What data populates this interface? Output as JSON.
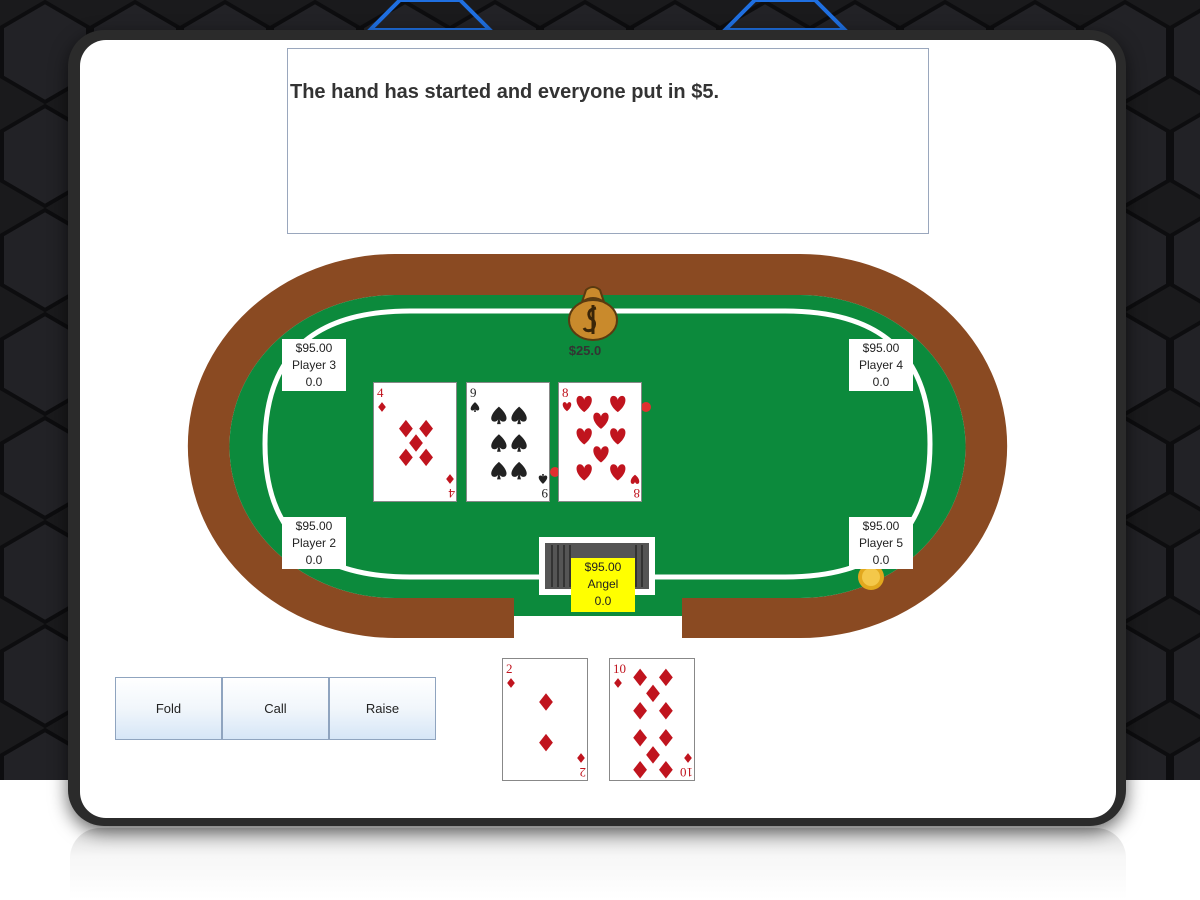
{
  "message": "The hand has started and everyone put in $5.",
  "pot": {
    "amount": "$25.0",
    "icon": "money-bag-icon"
  },
  "players": [
    {
      "id": "player3",
      "stack": "$95.00",
      "name": "Player 3",
      "bet": "0.0"
    },
    {
      "id": "player4",
      "stack": "$95.00",
      "name": "Player 4",
      "bet": "0.0"
    },
    {
      "id": "player2",
      "stack": "$95.00",
      "name": "Player 2",
      "bet": "0.0"
    },
    {
      "id": "player5",
      "stack": "$95.00",
      "name": "Player 5",
      "bet": "0.0"
    },
    {
      "id": "hero",
      "stack": "$95.00",
      "name": "Angel",
      "bet": "0.0"
    }
  ],
  "community_cards": [
    {
      "rank": "4",
      "suit": "diamonds"
    },
    {
      "rank": "9",
      "suit": "spades"
    },
    {
      "rank": "8",
      "suit": "hearts"
    }
  ],
  "hole_cards": [
    {
      "rank": "2",
      "suit": "diamonds"
    },
    {
      "rank": "10",
      "suit": "diamonds"
    }
  ],
  "actions": {
    "fold": "Fold",
    "call": "Call",
    "raise": "Raise"
  },
  "colors": {
    "felt": "#0c8a3c",
    "rail": "#8a4a22",
    "hero_highlight": "#ffff00",
    "red_suit": "#c0141e",
    "black_suit": "#222222"
  }
}
